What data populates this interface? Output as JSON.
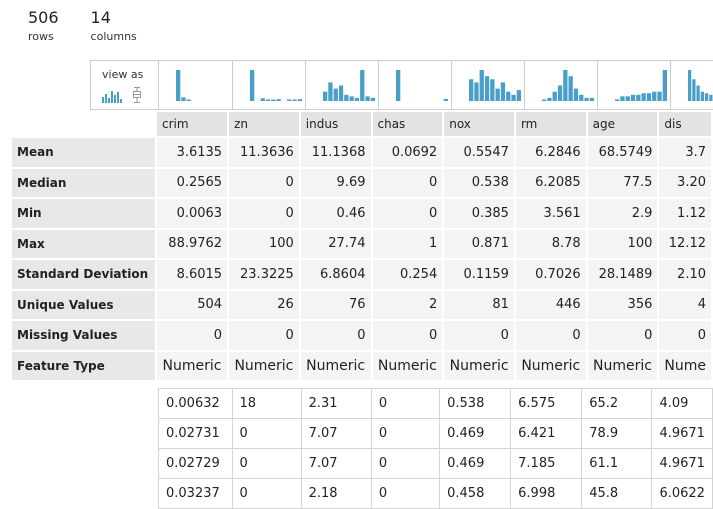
{
  "summary": {
    "rows_value": "506",
    "rows_label": "rows",
    "columns_value": "14",
    "columns_label": "columns"
  },
  "view_as": {
    "label": "view as",
    "histogram_icon": "histogram-icon",
    "boxplot_icon": "boxplot-icon"
  },
  "colors": {
    "bar": "#4a9fc8",
    "header_bg": "#e3e3e3",
    "cell_bg": "#f4f4f4"
  },
  "columns": [
    "crim",
    "zn",
    "indus",
    "chas",
    "nox",
    "rm",
    "age",
    "dis"
  ],
  "histograms": [
    [
      1,
      0.12,
      0.03,
      0,
      0,
      0,
      0,
      0,
      0,
      0
    ],
    [
      1,
      0,
      0.09,
      0.05,
      0.03,
      0.06,
      0,
      0.04,
      0.02,
      0.06
    ],
    [
      0.3,
      0.6,
      0.4,
      0.5,
      0.2,
      0.15,
      0.1,
      1,
      0.15,
      0.1
    ],
    [
      1,
      0,
      0,
      0,
      0,
      0,
      0,
      0,
      0,
      0.07
    ],
    [
      0.7,
      0.6,
      1,
      0.8,
      0.7,
      0.4,
      0.6,
      0.3,
      0.2,
      0.35
    ],
    [
      0.05,
      0.1,
      0.3,
      0.5,
      1,
      0.8,
      0.4,
      0.2,
      0.1,
      0.1
    ],
    [
      0.05,
      0.15,
      0.15,
      0.2,
      0.2,
      0.25,
      0.25,
      0.3,
      0.3,
      1
    ],
    [
      1,
      0.7,
      0.5,
      0.3,
      0.25,
      0.2,
      0.15,
      0.1
    ]
  ],
  "stat_rows": [
    {
      "label": "Mean",
      "values": [
        "3.6135",
        "11.3636",
        "11.1368",
        "0.0692",
        "0.5547",
        "6.2846",
        "68.5749",
        "3.7"
      ]
    },
    {
      "label": "Median",
      "values": [
        "0.2565",
        "0",
        "9.69",
        "0",
        "0.538",
        "6.2085",
        "77.5",
        "3.20"
      ]
    },
    {
      "label": "Min",
      "values": [
        "0.0063",
        "0",
        "0.46",
        "0",
        "0.385",
        "3.561",
        "2.9",
        "1.12"
      ]
    },
    {
      "label": "Max",
      "values": [
        "88.9762",
        "100",
        "27.74",
        "1",
        "0.871",
        "8.78",
        "100",
        "12.12"
      ]
    },
    {
      "label": "Standard Deviation",
      "values": [
        "8.6015",
        "23.3225",
        "6.8604",
        "0.254",
        "0.1159",
        "0.7026",
        "28.1489",
        "2.10"
      ]
    },
    {
      "label": "Unique Values",
      "values": [
        "504",
        "26",
        "76",
        "2",
        "81",
        "446",
        "356",
        "4"
      ]
    },
    {
      "label": "Missing Values",
      "values": [
        "0",
        "0",
        "0",
        "0",
        "0",
        "0",
        "0",
        "0"
      ]
    },
    {
      "label": "Feature Type",
      "values": [
        "Numeric",
        "Numeric",
        "Numeric",
        "Numeric",
        "Numeric",
        "Numeric",
        "Numeric",
        "Nume"
      ]
    }
  ],
  "data_rows": [
    [
      "0.00632",
      "18",
      "2.31",
      "0",
      "0.538",
      "6.575",
      "65.2",
      "4.09"
    ],
    [
      "0.02731",
      "0",
      "7.07",
      "0",
      "0.469",
      "6.421",
      "78.9",
      "4.9671"
    ],
    [
      "0.02729",
      "0",
      "7.07",
      "0",
      "0.469",
      "7.185",
      "61.1",
      "4.9671"
    ],
    [
      "0.03237",
      "0",
      "2.18",
      "0",
      "0.458",
      "6.998",
      "45.8",
      "6.0622"
    ]
  ]
}
